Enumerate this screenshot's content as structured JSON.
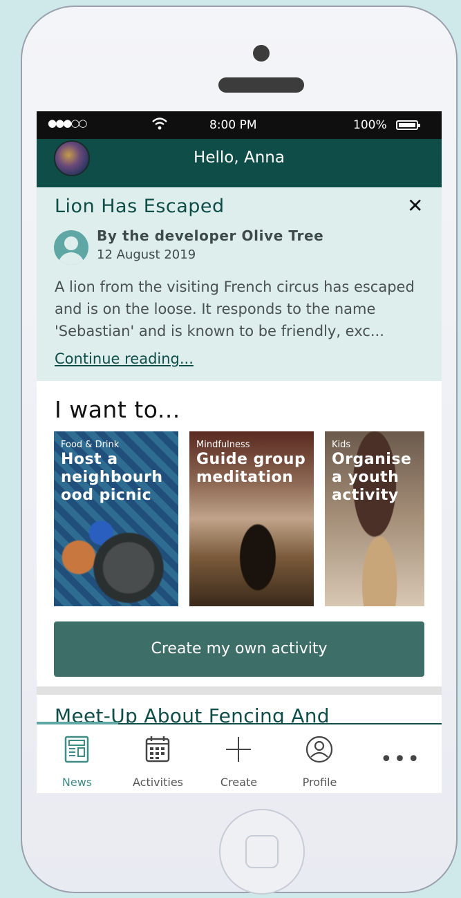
{
  "status_bar": {
    "signal": "●●●○○",
    "time": "8:00 PM",
    "battery": "100%"
  },
  "header": {
    "greeting": "Hello, Anna"
  },
  "news": {
    "title": "Lion Has Escaped",
    "close_label": "✕",
    "author": "By the developer Olive Tree",
    "date": "12 August 2019",
    "body": "A lion from the visiting French circus has escaped and is on the loose. It responds to the name 'Sebastian' and is known to be friendly, exc...",
    "more_link": "Continue reading..."
  },
  "want": {
    "title": "I want to...",
    "cards": [
      {
        "category": "Food & Drink",
        "title": "Host a neighbourh ood picnic"
      },
      {
        "category": "Mindfulness",
        "title": "Guide group meditation"
      },
      {
        "category": "Kids",
        "title": "Organise a youth activity"
      }
    ],
    "create_button": "Create my own activity"
  },
  "next_item": {
    "title": "Meet-Up About Fencing And"
  },
  "tabs": [
    {
      "label": "News",
      "icon": "newspaper-icon",
      "active": true
    },
    {
      "label": "Activities",
      "icon": "calendar-icon",
      "active": false
    },
    {
      "label": "Create",
      "icon": "plus-icon",
      "active": false
    },
    {
      "label": "Profile",
      "icon": "profile-icon",
      "active": false
    },
    {
      "label": "",
      "icon": "more-icon",
      "active": false
    }
  ],
  "colors": {
    "brand": "#0f4d48",
    "accent": "#3e6e68",
    "news_bg": "#ddeeed",
    "tab_active": "#3e8c85"
  }
}
